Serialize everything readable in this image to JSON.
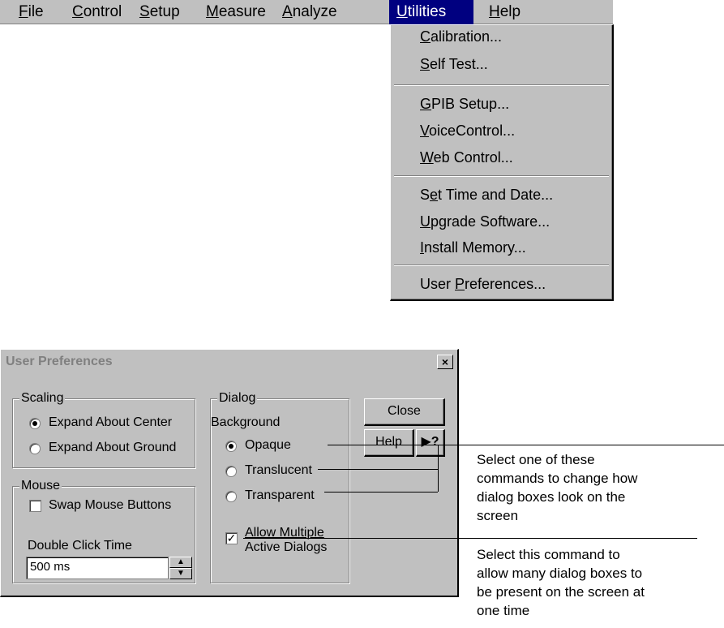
{
  "menubar": {
    "items": [
      {
        "label": "File"
      },
      {
        "label": "Control"
      },
      {
        "label": "Setup"
      },
      {
        "label": "Measure"
      },
      {
        "label": "Analyze"
      },
      {
        "label": "Utilities"
      },
      {
        "label": "Help"
      }
    ]
  },
  "utilities_menu": {
    "items": [
      {
        "label": "Calibration..."
      },
      {
        "label": "Self Test..."
      },
      {
        "label": "GPIB Setup..."
      },
      {
        "label": "VoiceControl..."
      },
      {
        "label": "Web Control..."
      },
      {
        "label": "Set Time and Date..."
      },
      {
        "label": "Upgrade Software..."
      },
      {
        "label": "Install Memory..."
      },
      {
        "label": "User Preferences..."
      }
    ]
  },
  "dialog": {
    "title": "User Preferences",
    "close_glyph": "×",
    "scaling": {
      "label": "Scaling",
      "options": [
        {
          "label": "Expand About Center",
          "selected": true
        },
        {
          "label": "Expand About Ground",
          "selected": false
        }
      ]
    },
    "mouse": {
      "label": "Mouse",
      "swap_label": "Swap Mouse Buttons",
      "swap_checked": false,
      "double_click_label": "Double Click Time",
      "double_click_value": "500 ms"
    },
    "dialog_group": {
      "label": "Dialog",
      "background_label": "Background",
      "options": [
        {
          "label": "Opaque",
          "selected": true
        },
        {
          "label": "Translucent",
          "selected": false
        },
        {
          "label": "Transparent",
          "selected": false
        }
      ],
      "allow_multiple_line1": "Allow Multiple",
      "allow_multiple_line2": "Active Dialogs",
      "allow_multiple_checked": true
    },
    "buttons": {
      "close": "Close",
      "help": "Help",
      "whats_this": "?"
    }
  },
  "callouts": {
    "first": [
      "Select one of these",
      "commands to change how",
      "dialog boxes look on the",
      "screen"
    ],
    "second": [
      "Select this command to",
      "allow many dialog boxes to",
      "be present on the screen at",
      "one time"
    ]
  }
}
